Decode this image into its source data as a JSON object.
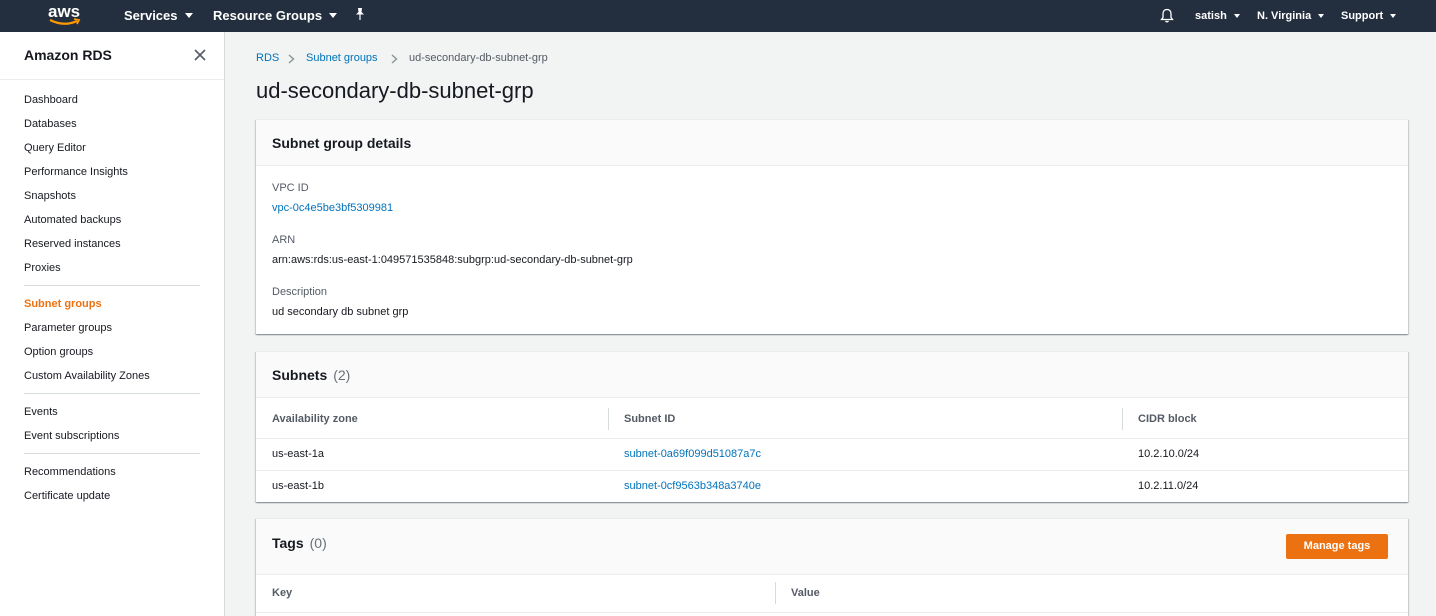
{
  "topnav": {
    "logo_text": "aws",
    "services_label": "Services",
    "resource_groups_label": "Resource Groups",
    "user_label": "satish",
    "region_label": "N. Virginia",
    "support_label": "Support",
    "icons": [
      "pin-icon",
      "bell-icon"
    ]
  },
  "sidebar": {
    "title": "Amazon RDS",
    "items": [
      {
        "label": "Dashboard"
      },
      {
        "label": "Databases"
      },
      {
        "label": "Query Editor"
      },
      {
        "label": "Performance Insights"
      },
      {
        "label": "Snapshots"
      },
      {
        "label": "Automated backups"
      },
      {
        "label": "Reserved instances"
      },
      {
        "label": "Proxies"
      },
      {
        "label": "Subnet groups",
        "active": true
      },
      {
        "label": "Parameter groups"
      },
      {
        "label": "Option groups"
      },
      {
        "label": "Custom Availability Zones"
      },
      {
        "label": "Events"
      },
      {
        "label": "Event subscriptions"
      },
      {
        "label": "Recommendations"
      },
      {
        "label": "Certificate update"
      }
    ]
  },
  "breadcrumb": {
    "items": [
      "RDS",
      "Subnet groups",
      "ud-secondary-db-subnet-grp"
    ]
  },
  "page_title": "ud-secondary-db-subnet-grp",
  "details": {
    "title": "Subnet group details",
    "vpc_label": "VPC ID",
    "vpc_value": "vpc-0c4e5be3bf5309981",
    "arn_label": "ARN",
    "arn_value": "arn:aws:rds:us-east-1:049571535848:subgrp:ud-secondary-db-subnet-grp",
    "desc_label": "Description",
    "desc_value": "ud secondary db subnet grp"
  },
  "subnets": {
    "title": "Subnets",
    "count": "(2)",
    "columns": [
      "Availability zone",
      "Subnet ID",
      "CIDR block"
    ],
    "rows": [
      {
        "zone": "us-east-1a",
        "subnet_id": "subnet-0a69f099d51087a7c",
        "cidr": "10.2.10.0/24"
      },
      {
        "zone": "us-east-1b",
        "subnet_id": "subnet-0cf9563b348a3740e",
        "cidr": "10.2.11.0/24"
      }
    ]
  },
  "tags": {
    "title": "Tags",
    "count": "(0)",
    "manage_label": "Manage tags",
    "columns": [
      "Key",
      "Value"
    ]
  },
  "colors": {
    "nav_bg": "#232f3e",
    "accent_orange": "#ec7211",
    "link_blue": "#0073bb"
  }
}
